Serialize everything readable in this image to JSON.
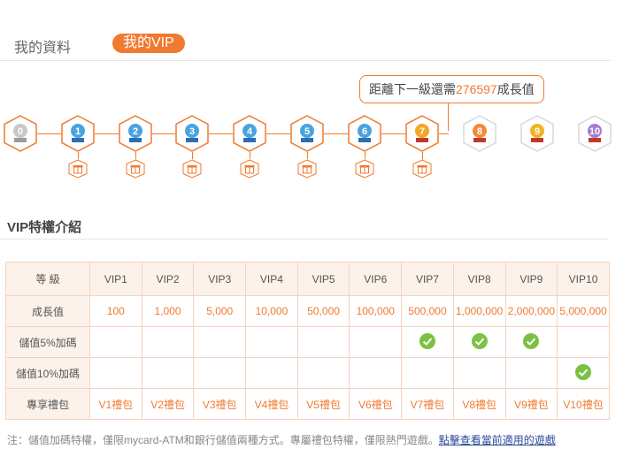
{
  "tabs": {
    "profile": "我的資料",
    "vip": "我的VIP"
  },
  "progress": {
    "prefix": "距離下一級還需",
    "value": "276597",
    "suffix": "成長值",
    "current_level": 7
  },
  "levels": [
    "0",
    "1",
    "2",
    "3",
    "4",
    "5",
    "6",
    "7",
    "8",
    "9",
    "10"
  ],
  "colors": {
    "accent": "#f07a30",
    "check": "#7bc143",
    "unlocked": "#4aa3df",
    "gold": "#f5a623",
    "purple": "#a77bd1"
  },
  "section_title": "VIP特權介紹",
  "table": {
    "corner": "等 級",
    "headers": [
      "VIP1",
      "VIP2",
      "VIP3",
      "VIP4",
      "VIP5",
      "VIP6",
      "VIP7",
      "VIP8",
      "VIP9",
      "VIP10"
    ],
    "growth_label": "成長值",
    "growth": [
      "100",
      "1,000",
      "5,000",
      "10,000",
      "50,000",
      "100,000",
      "500,000",
      "1,000,000",
      "2,000,000",
      "5,000,000"
    ],
    "bonus5_label": "儲值5%加碼",
    "bonus5": [
      false,
      false,
      false,
      false,
      false,
      false,
      true,
      true,
      true,
      false
    ],
    "bonus10_label": "儲值10%加碼",
    "bonus10": [
      false,
      false,
      false,
      false,
      false,
      false,
      false,
      false,
      false,
      true
    ],
    "gift_label": "專享禮包",
    "gifts": [
      "V1禮包",
      "V2禮包",
      "V3禮包",
      "V4禮包",
      "V5禮包",
      "V6禮包",
      "V7禮包",
      "V8禮包",
      "V9禮包",
      "V10禮包"
    ]
  },
  "note": {
    "text": "注：儲值加碼特權，僅限mycard-ATM和銀行儲值兩種方式。專屬禮包特權，僅限熱門遊戲。",
    "link": "點擊查看當前適用的遊戲"
  }
}
